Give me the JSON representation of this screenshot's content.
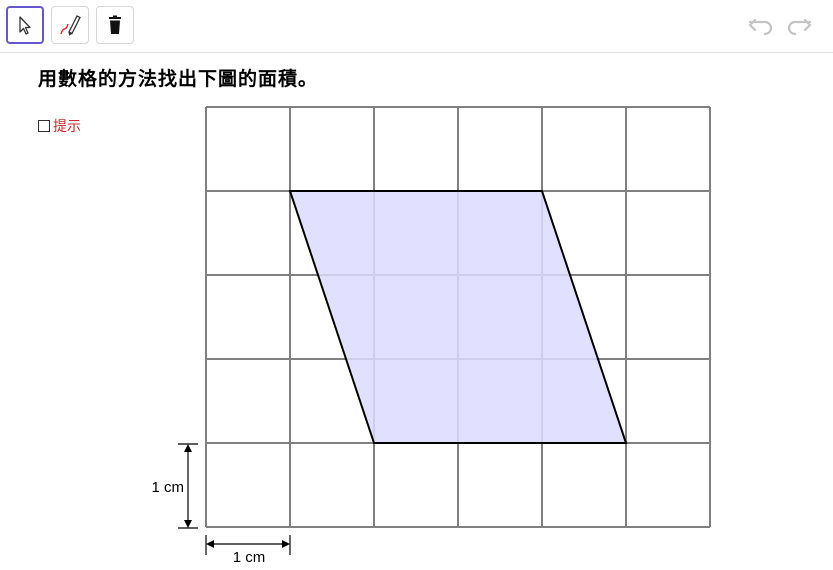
{
  "toolbar": {
    "tools": [
      {
        "name": "move-tool",
        "icon": "arrow-cursor-icon",
        "active": true
      },
      {
        "name": "pen-tool",
        "icon": "pen-icon",
        "active": false
      },
      {
        "name": "delete-tool",
        "icon": "trash-icon",
        "active": false
      }
    ],
    "undo_icon": "undo-icon",
    "redo_icon": "redo-icon"
  },
  "question": {
    "text": "用數格的方法找出下圖的面積。"
  },
  "hint": {
    "label": "提示",
    "checked": false
  },
  "figure": {
    "grid_columns": 6,
    "grid_rows": 5,
    "parallelogram": [
      [
        1,
        1
      ],
      [
        4,
        1
      ],
      [
        5,
        4
      ],
      [
        2,
        4
      ]
    ],
    "fill_color": "#dcdcff",
    "stroke_color": "#000000",
    "grid_color": "#808080",
    "vertical_unit_label": "1 cm",
    "horizontal_unit_label": "1 cm"
  }
}
